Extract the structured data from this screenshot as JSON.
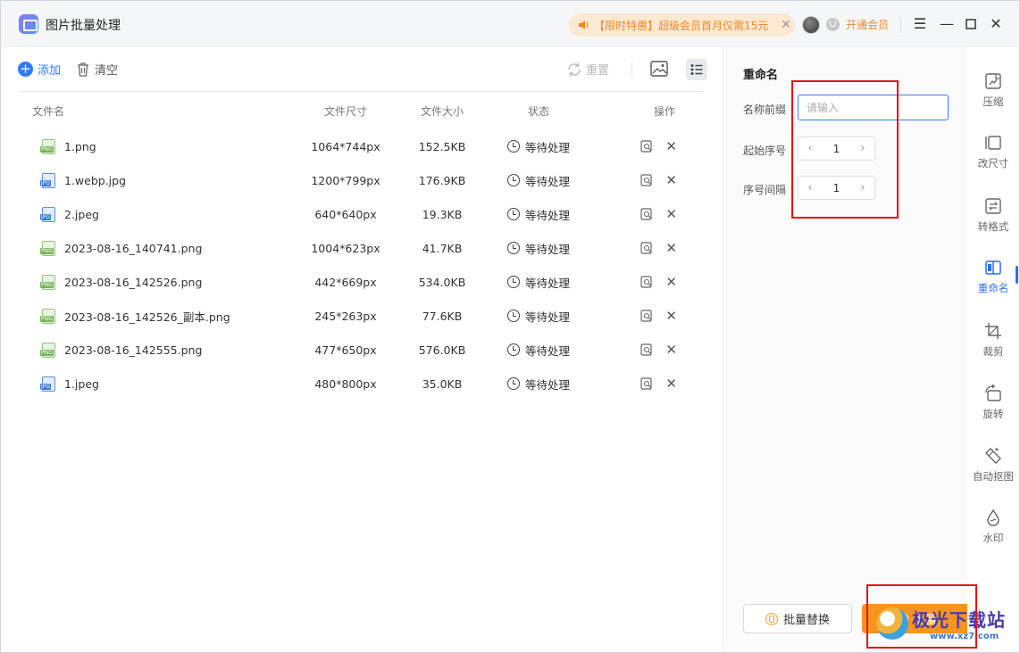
{
  "titlebar": {
    "app_title": "图片批量处理",
    "promo_text": "【限时特惠】超级会员首月仅需15元",
    "vip_label": "开通会员"
  },
  "toolbar": {
    "add_label": "添加",
    "clear_label": "清空",
    "reset_label": "重置"
  },
  "table": {
    "columns": [
      "文件名",
      "文件尺寸",
      "文件大小",
      "状态",
      "操作"
    ],
    "rows": [
      {
        "name": "1.png",
        "type": "png",
        "dim": "1064*744px",
        "size": "152.5KB",
        "status": "等待处理"
      },
      {
        "name": "1.webp.jpg",
        "type": "jpg",
        "dim": "1200*799px",
        "size": "176.9KB",
        "status": "等待处理"
      },
      {
        "name": "2.jpeg",
        "type": "jpg",
        "dim": "640*640px",
        "size": "19.3KB",
        "status": "等待处理"
      },
      {
        "name": "2023-08-16_140741.png",
        "type": "png",
        "dim": "1004*623px",
        "size": "41.7KB",
        "status": "等待处理"
      },
      {
        "name": "2023-08-16_142526.png",
        "type": "png",
        "dim": "442*669px",
        "size": "534.0KB",
        "status": "等待处理"
      },
      {
        "name": "2023-08-16_142526_副本.png",
        "type": "png",
        "dim": "245*263px",
        "size": "77.6KB",
        "status": "等待处理"
      },
      {
        "name": "2023-08-16_142555.png",
        "type": "png",
        "dim": "477*650px",
        "size": "576.0KB",
        "status": "等待处理"
      },
      {
        "name": "1.jpeg",
        "type": "jpg",
        "dim": "480*800px",
        "size": "35.0KB",
        "status": "等待处理"
      }
    ],
    "badges": {
      "png": "PNG",
      "jpg": "JPG"
    }
  },
  "panel": {
    "title": "重命名",
    "prefix_label": "名称前缀",
    "prefix_placeholder": "请输入",
    "start_label": "起始序号",
    "start_value": "1",
    "step_label": "序号间隔",
    "step_value": "1",
    "replace_button": "批量替换",
    "rename_button": "批量"
  },
  "nav": {
    "items": [
      {
        "label": "压缩",
        "icon": "compress-icon"
      },
      {
        "label": "改尺寸",
        "icon": "resize-icon"
      },
      {
        "label": "转格式",
        "icon": "convert-icon"
      },
      {
        "label": "重命名",
        "icon": "rename-icon",
        "active": true
      },
      {
        "label": "裁剪",
        "icon": "crop-icon"
      },
      {
        "label": "旋转",
        "icon": "rotate-icon"
      },
      {
        "label": "自动抠图",
        "icon": "cutout-icon"
      },
      {
        "label": "水印",
        "icon": "watermark-icon"
      }
    ]
  },
  "watermark": {
    "brand": "极光下载站",
    "url": "www.xz7.com"
  },
  "colors": {
    "accent": "#2f7bf6",
    "orange": "#f7941d",
    "annotation_red": "#e0141c"
  }
}
